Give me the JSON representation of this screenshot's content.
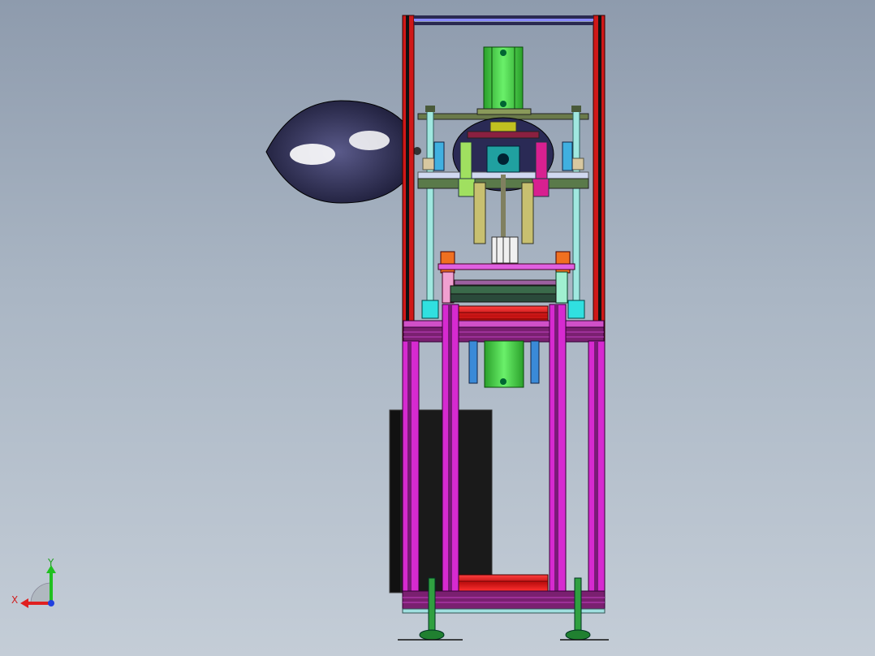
{
  "viewport": {
    "background_top": "#8e9bad",
    "background_bottom": "#c4cdd7"
  },
  "triad": {
    "x_label": "X",
    "y_label": "Y",
    "x_color": "#e02020",
    "y_color": "#20c020",
    "z_color": "#2040e0"
  },
  "colors": {
    "frame_red": "#d81e1e",
    "frame_magenta": "#d62ad0",
    "shaft_green": "#3fd53f",
    "rod_cyan": "#7fe0e0",
    "dark_body": "#1a1a1a",
    "sphere": "#2a2a55",
    "plate_olive": "#7a8a5a",
    "block_orange": "#f07020",
    "cylinder_blue": "#3a8ad8"
  }
}
